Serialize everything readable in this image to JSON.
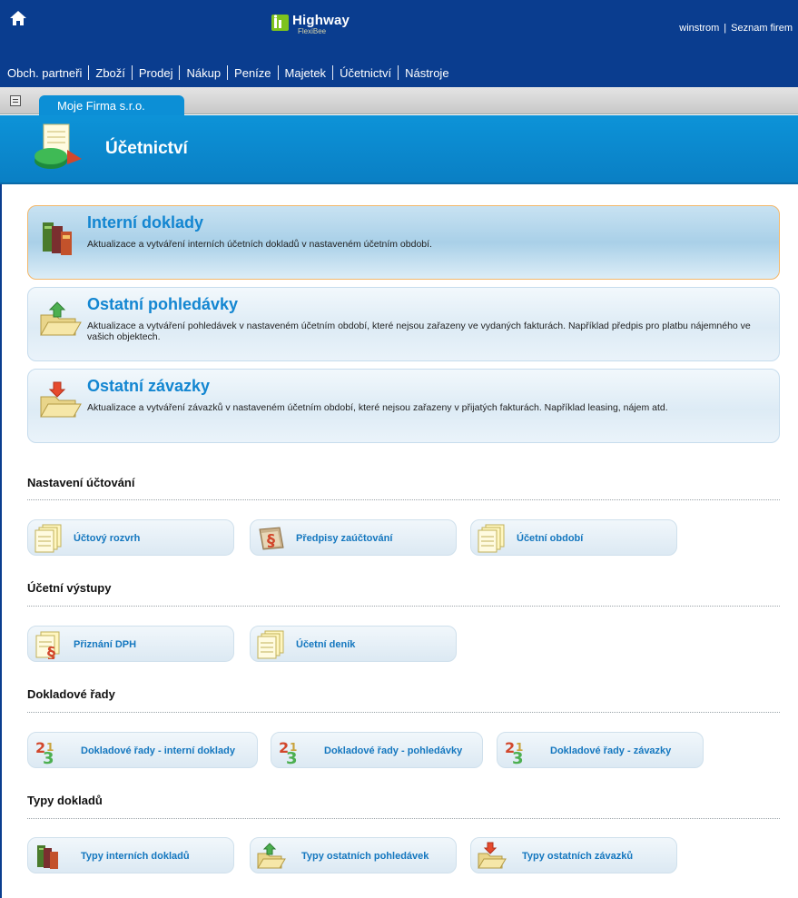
{
  "header": {
    "logo_text": "Highway",
    "logo_sub": "FlexiBee",
    "user": "winstrom",
    "company_list_link": "Seznam firem",
    "separator": "|"
  },
  "nav": [
    "Obch. partneři",
    "Zboží",
    "Prodej",
    "Nákup",
    "Peníze",
    "Majetek",
    "Účetnictví",
    "Nástroje"
  ],
  "tab": {
    "label": "Moje Firma s.r.o."
  },
  "page": {
    "title": "Účetnictví"
  },
  "cards": [
    {
      "title": "Interní doklady",
      "desc": "Aktualizace a vytváření interních účetních dokladů v nastaveném účetním období.",
      "icon": "books-icon"
    },
    {
      "title": "Ostatní pohledávky",
      "desc": "Aktualizace a vytváření pohledávek v nastaveném účetním období, které nejsou zařazeny ve vydaných fakturách. Například předpis pro platbu nájemného ve vašich objektech.",
      "icon": "folder-up-icon"
    },
    {
      "title": "Ostatní závazky",
      "desc": "Aktualizace a vytváření závazků v nastaveném účetním období, které nejsou zařazeny v přijatých fakturách. Například leasing, nájem atd.",
      "icon": "folder-down-icon"
    }
  ],
  "sections": {
    "nastaveni": {
      "title": "Nastavení účtování",
      "items": [
        "Účtový rozvrh",
        "Předpisy zaúčtování",
        "Účetní období"
      ]
    },
    "vystupy": {
      "title": "Účetní výstupy",
      "items": [
        "Přiznání DPH",
        "Účetní deník"
      ]
    },
    "rady": {
      "title": "Dokladové řady",
      "items": [
        "Dokladové řady - interní doklady",
        "Dokladové řady - pohledávky",
        "Dokladové řady - závazky"
      ]
    },
    "typy": {
      "title": "Typy dokladů",
      "items": [
        "Typy interních dokladů",
        "Typy ostatních pohledávek",
        "Typy ostatních závazků"
      ]
    }
  },
  "colors": {
    "topbar": "#0a3d8f",
    "header_blue": "#0d93d8",
    "link_blue": "#1477bf",
    "active_border": "#f3b76a"
  }
}
